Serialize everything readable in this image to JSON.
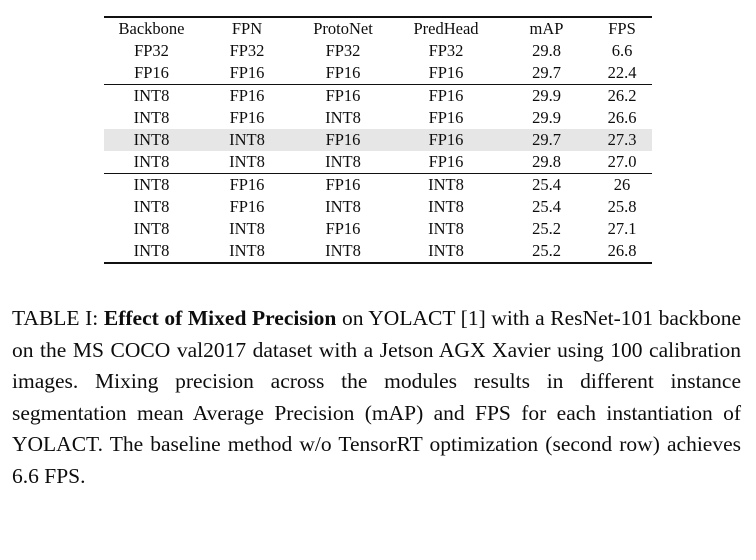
{
  "table": {
    "columns": [
      "Backbone",
      "FPN",
      "ProtoNet",
      "PredHead",
      "mAP",
      "FPS"
    ],
    "rows": [
      {
        "backbone": "FP32",
        "fpn": "FP32",
        "protonet": "FP32",
        "predhead": "FP32",
        "map": "29.8",
        "fps": "6.6",
        "bold": {
          "backbone": false,
          "fpn": false,
          "protonet": false,
          "predhead": false,
          "map": true,
          "fps": false
        },
        "highlight": false,
        "rule_above": false
      },
      {
        "backbone": "FP16",
        "fpn": "FP16",
        "protonet": "FP16",
        "predhead": "FP16",
        "map": "29.7",
        "fps": "22.4",
        "bold": {
          "backbone": false,
          "fpn": false,
          "protonet": false,
          "predhead": false,
          "map": false,
          "fps": false
        },
        "highlight": false,
        "rule_above": false
      },
      {
        "backbone": "INT8",
        "fpn": "FP16",
        "protonet": "FP16",
        "predhead": "FP16",
        "map": "29.9",
        "fps": "26.2",
        "bold": {
          "backbone": false,
          "fpn": false,
          "protonet": false,
          "predhead": false,
          "map": false,
          "fps": false
        },
        "highlight": false,
        "rule_above": true
      },
      {
        "backbone": "INT8",
        "fpn": "FP16",
        "protonet": "INT8",
        "predhead": "FP16",
        "map": "29.9",
        "fps": "26.6",
        "bold": {
          "backbone": false,
          "fpn": false,
          "protonet": false,
          "predhead": false,
          "map": false,
          "fps": false
        },
        "highlight": false,
        "rule_above": false
      },
      {
        "backbone": "INT8",
        "fpn": "INT8",
        "protonet": "FP16",
        "predhead": "FP16",
        "map": "29.7",
        "fps": "27.3",
        "bold": {
          "backbone": true,
          "fpn": true,
          "protonet": true,
          "predhead": true,
          "map": false,
          "fps": true
        },
        "highlight": true,
        "rule_above": false
      },
      {
        "backbone": "INT8",
        "fpn": "INT8",
        "protonet": "INT8",
        "predhead": "FP16",
        "map": "29.8",
        "fps": "27.0",
        "bold": {
          "backbone": false,
          "fpn": false,
          "protonet": false,
          "predhead": false,
          "map": false,
          "fps": false
        },
        "highlight": false,
        "rule_above": false
      },
      {
        "backbone": "INT8",
        "fpn": "FP16",
        "protonet": "FP16",
        "predhead": "INT8",
        "map": "25.4",
        "fps": "26",
        "bold": {
          "backbone": false,
          "fpn": false,
          "protonet": false,
          "predhead": false,
          "map": false,
          "fps": false
        },
        "highlight": false,
        "rule_above": true
      },
      {
        "backbone": "INT8",
        "fpn": "FP16",
        "protonet": "INT8",
        "predhead": "INT8",
        "map": "25.4",
        "fps": "25.8",
        "bold": {
          "backbone": false,
          "fpn": false,
          "protonet": false,
          "predhead": false,
          "map": false,
          "fps": false
        },
        "highlight": false,
        "rule_above": false
      },
      {
        "backbone": "INT8",
        "fpn": "INT8",
        "protonet": "FP16",
        "predhead": "INT8",
        "map": "25.2",
        "fps": "27.1",
        "bold": {
          "backbone": false,
          "fpn": false,
          "protonet": false,
          "predhead": false,
          "map": false,
          "fps": false
        },
        "highlight": false,
        "rule_above": false
      },
      {
        "backbone": "INT8",
        "fpn": "INT8",
        "protonet": "INT8",
        "predhead": "INT8",
        "map": "25.2",
        "fps": "26.8",
        "bold": {
          "backbone": false,
          "fpn": false,
          "protonet": false,
          "predhead": false,
          "map": false,
          "fps": false
        },
        "highlight": false,
        "rule_above": false
      }
    ],
    "highlight_color": "#e6e6e6",
    "rule_color": "#111111"
  },
  "caption": {
    "label": "TABLE I: ",
    "bold_phrase": "Effect of Mixed Precision",
    "body": " on YOLACT [1] with a ResNet-101 backbone on the MS COCO val2017 dataset with a Jetson AGX Xavier using 100 calibration images. Mixing precision across the modules results in different instance segmentation mean Average Precision (mAP) and FPS for each instantiation of YOLACT. The baseline method w/o TensorRT optimization (second row) achieves 6.6 FPS."
  }
}
